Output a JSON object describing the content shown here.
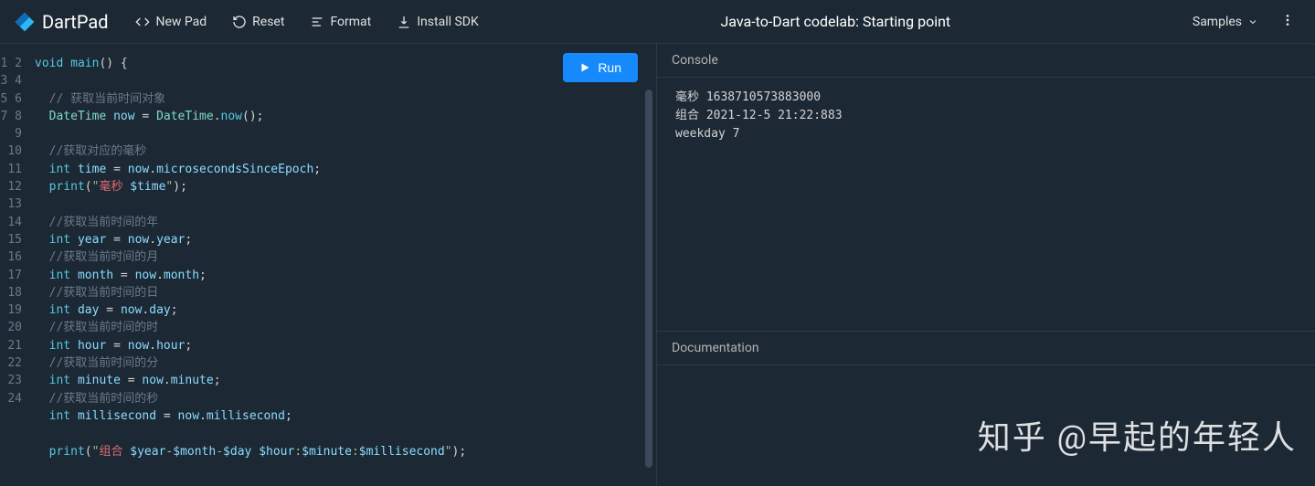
{
  "header": {
    "logo": "DartPad",
    "newPad": "New Pad",
    "reset": "Reset",
    "format": "Format",
    "installSdk": "Install SDK",
    "title": "Java-to-Dart codelab: Starting point",
    "samples": "Samples"
  },
  "run": "Run",
  "code": {
    "lines": [
      [
        {
          "t": "void",
          "c": "kw"
        },
        {
          "t": " "
        },
        {
          "t": "main",
          "c": "fn"
        },
        {
          "t": "() {",
          "c": "punc"
        }
      ],
      [],
      [
        {
          "t": "  "
        },
        {
          "t": "// 获取当前时间对象",
          "c": "cmt"
        }
      ],
      [
        {
          "t": "  "
        },
        {
          "t": "DateTime",
          "c": "type"
        },
        {
          "t": " "
        },
        {
          "t": "now",
          "c": "ident"
        },
        {
          "t": " = ",
          "c": "punc"
        },
        {
          "t": "DateTime",
          "c": "type"
        },
        {
          "t": ".",
          "c": "punc"
        },
        {
          "t": "now",
          "c": "fn"
        },
        {
          "t": "();",
          "c": "punc"
        }
      ],
      [],
      [
        {
          "t": "  "
        },
        {
          "t": "//获取对应的毫秒",
          "c": "cmt"
        }
      ],
      [
        {
          "t": "  "
        },
        {
          "t": "int",
          "c": "kw"
        },
        {
          "t": " "
        },
        {
          "t": "time",
          "c": "ident"
        },
        {
          "t": " = ",
          "c": "punc"
        },
        {
          "t": "now",
          "c": "ident"
        },
        {
          "t": ".",
          "c": "punc"
        },
        {
          "t": "microsecondsSinceEpoch",
          "c": "prop"
        },
        {
          "t": ";",
          "c": "punc"
        }
      ],
      [
        {
          "t": "  "
        },
        {
          "t": "print",
          "c": "fn"
        },
        {
          "t": "(",
          "c": "punc"
        },
        {
          "t": "\"",
          "c": "str"
        },
        {
          "t": "毫秒 ",
          "c": "str-zh"
        },
        {
          "t": "$time",
          "c": "var"
        },
        {
          "t": "\"",
          "c": "str"
        },
        {
          "t": ");",
          "c": "punc"
        }
      ],
      [],
      [
        {
          "t": "  "
        },
        {
          "t": "//获取当前时间的年",
          "c": "cmt"
        }
      ],
      [
        {
          "t": "  "
        },
        {
          "t": "int",
          "c": "kw"
        },
        {
          "t": " "
        },
        {
          "t": "year",
          "c": "ident"
        },
        {
          "t": " = ",
          "c": "punc"
        },
        {
          "t": "now",
          "c": "ident"
        },
        {
          "t": ".",
          "c": "punc"
        },
        {
          "t": "year",
          "c": "prop"
        },
        {
          "t": ";",
          "c": "punc"
        }
      ],
      [
        {
          "t": "  "
        },
        {
          "t": "//获取当前时间的月",
          "c": "cmt"
        }
      ],
      [
        {
          "t": "  "
        },
        {
          "t": "int",
          "c": "kw"
        },
        {
          "t": " "
        },
        {
          "t": "month",
          "c": "ident"
        },
        {
          "t": " = ",
          "c": "punc"
        },
        {
          "t": "now",
          "c": "ident"
        },
        {
          "t": ".",
          "c": "punc"
        },
        {
          "t": "month",
          "c": "prop"
        },
        {
          "t": ";",
          "c": "punc"
        }
      ],
      [
        {
          "t": "  "
        },
        {
          "t": "//获取当前时间的日",
          "c": "cmt"
        }
      ],
      [
        {
          "t": "  "
        },
        {
          "t": "int",
          "c": "kw"
        },
        {
          "t": " "
        },
        {
          "t": "day",
          "c": "ident"
        },
        {
          "t": " = ",
          "c": "punc"
        },
        {
          "t": "now",
          "c": "ident"
        },
        {
          "t": ".",
          "c": "punc"
        },
        {
          "t": "day",
          "c": "prop"
        },
        {
          "t": ";",
          "c": "punc"
        }
      ],
      [
        {
          "t": "  "
        },
        {
          "t": "//获取当前时间的时",
          "c": "cmt"
        }
      ],
      [
        {
          "t": "  "
        },
        {
          "t": "int",
          "c": "kw"
        },
        {
          "t": " "
        },
        {
          "t": "hour",
          "c": "ident"
        },
        {
          "t": " = ",
          "c": "punc"
        },
        {
          "t": "now",
          "c": "ident"
        },
        {
          "t": ".",
          "c": "punc"
        },
        {
          "t": "hour",
          "c": "prop"
        },
        {
          "t": ";",
          "c": "punc"
        }
      ],
      [
        {
          "t": "  "
        },
        {
          "t": "//获取当前时间的分",
          "c": "cmt"
        }
      ],
      [
        {
          "t": "  "
        },
        {
          "t": "int",
          "c": "kw"
        },
        {
          "t": " "
        },
        {
          "t": "minute",
          "c": "ident"
        },
        {
          "t": " = ",
          "c": "punc"
        },
        {
          "t": "now",
          "c": "ident"
        },
        {
          "t": ".",
          "c": "punc"
        },
        {
          "t": "minute",
          "c": "prop"
        },
        {
          "t": ";",
          "c": "punc"
        }
      ],
      [
        {
          "t": "  "
        },
        {
          "t": "//获取当前时间的秒",
          "c": "cmt"
        }
      ],
      [
        {
          "t": "  "
        },
        {
          "t": "int",
          "c": "kw"
        },
        {
          "t": " "
        },
        {
          "t": "millisecond",
          "c": "ident"
        },
        {
          "t": " = ",
          "c": "punc"
        },
        {
          "t": "now",
          "c": "ident"
        },
        {
          "t": ".",
          "c": "punc"
        },
        {
          "t": "millisecond",
          "c": "prop"
        },
        {
          "t": ";",
          "c": "punc"
        }
      ],
      [],
      [
        {
          "t": "  "
        },
        {
          "t": "print",
          "c": "fn"
        },
        {
          "t": "(",
          "c": "punc"
        },
        {
          "t": "\"",
          "c": "str"
        },
        {
          "t": "组合 ",
          "c": "str-zh"
        },
        {
          "t": "$year",
          "c": "var"
        },
        {
          "t": "-",
          "c": "str"
        },
        {
          "t": "$month",
          "c": "var"
        },
        {
          "t": "-",
          "c": "str"
        },
        {
          "t": "$day",
          "c": "var"
        },
        {
          "t": " ",
          "c": "str"
        },
        {
          "t": "$hour",
          "c": "var"
        },
        {
          "t": ":",
          "c": "str"
        },
        {
          "t": "$minute",
          "c": "var"
        },
        {
          "t": ":",
          "c": "str"
        },
        {
          "t": "$millisecond",
          "c": "var"
        },
        {
          "t": "\"",
          "c": "str"
        },
        {
          "t": ");",
          "c": "punc"
        }
      ],
      []
    ]
  },
  "console": {
    "header": "Console",
    "lines": [
      "毫秒 1638710573883000",
      "组合 2021-12-5 21:22:883",
      "weekday 7"
    ]
  },
  "docs": {
    "header": "Documentation"
  },
  "watermark": "知乎 @早起的年轻人"
}
